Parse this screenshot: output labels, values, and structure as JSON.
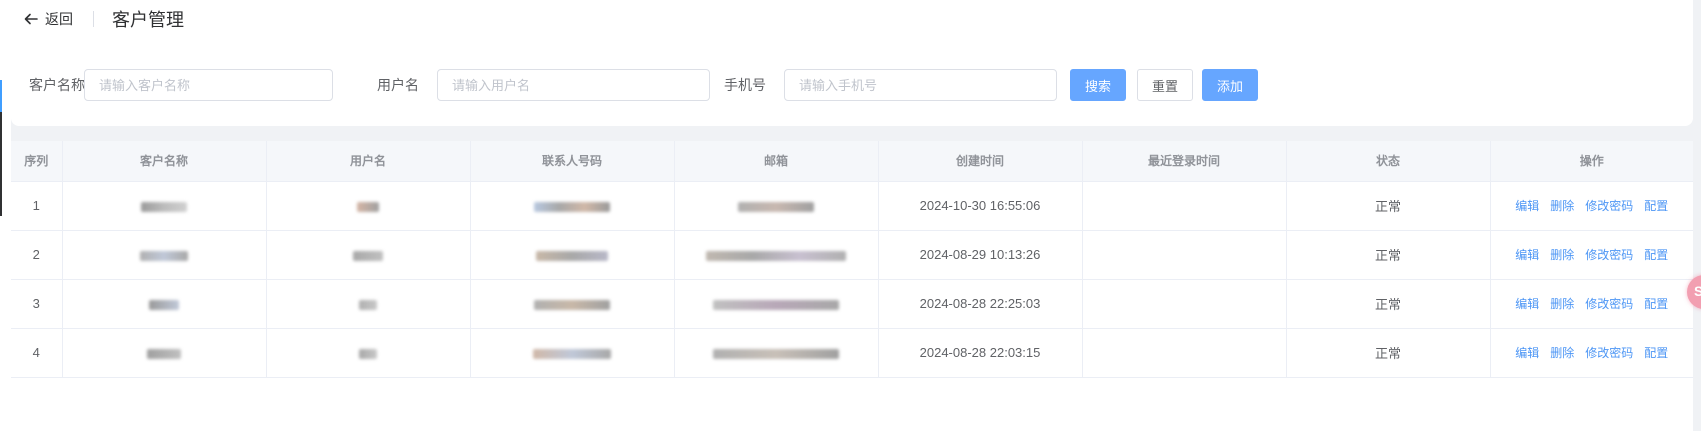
{
  "header": {
    "back_label": "返回",
    "title": "客户管理"
  },
  "search": {
    "customer_name_label": "客户名称",
    "customer_name_placeholder": "请输入客户名称",
    "customer_name_value": "",
    "username_label": "用户名",
    "username_placeholder": "请输入用户名",
    "username_value": "",
    "phone_label": "手机号",
    "phone_placeholder": "请输入手机号",
    "phone_value": "",
    "search_button": "搜索",
    "reset_button": "重置",
    "add_button": "添加"
  },
  "table": {
    "columns": [
      "序列",
      "客户名称",
      "用户名",
      "联系人号码",
      "邮箱",
      "创建时间",
      "最近登录时间",
      "状态",
      "操作"
    ],
    "rows": [
      {
        "index": "1",
        "created": "2024-10-30 16:55:06",
        "last_login": "",
        "status": "正常"
      },
      {
        "index": "2",
        "created": "2024-08-29 10:13:26",
        "last_login": "",
        "status": "正常"
      },
      {
        "index": "3",
        "created": "2024-08-28 22:25:03",
        "last_login": "",
        "status": "正常"
      },
      {
        "index": "4",
        "created": "2024-08-28 22:03:15",
        "last_login": "",
        "status": "正常"
      }
    ],
    "actions": {
      "edit": "编辑",
      "delete": "删除",
      "change_password": "修改密码",
      "config": "配置"
    }
  },
  "colors": {
    "primary": "#66a6ff",
    "link": "#4d96f5",
    "header_bg": "#f5f7fa",
    "page_bg": "#f0f2f5"
  },
  "icons": {
    "back": "arrow-left-icon",
    "floating": "floating-assistant-icon"
  }
}
